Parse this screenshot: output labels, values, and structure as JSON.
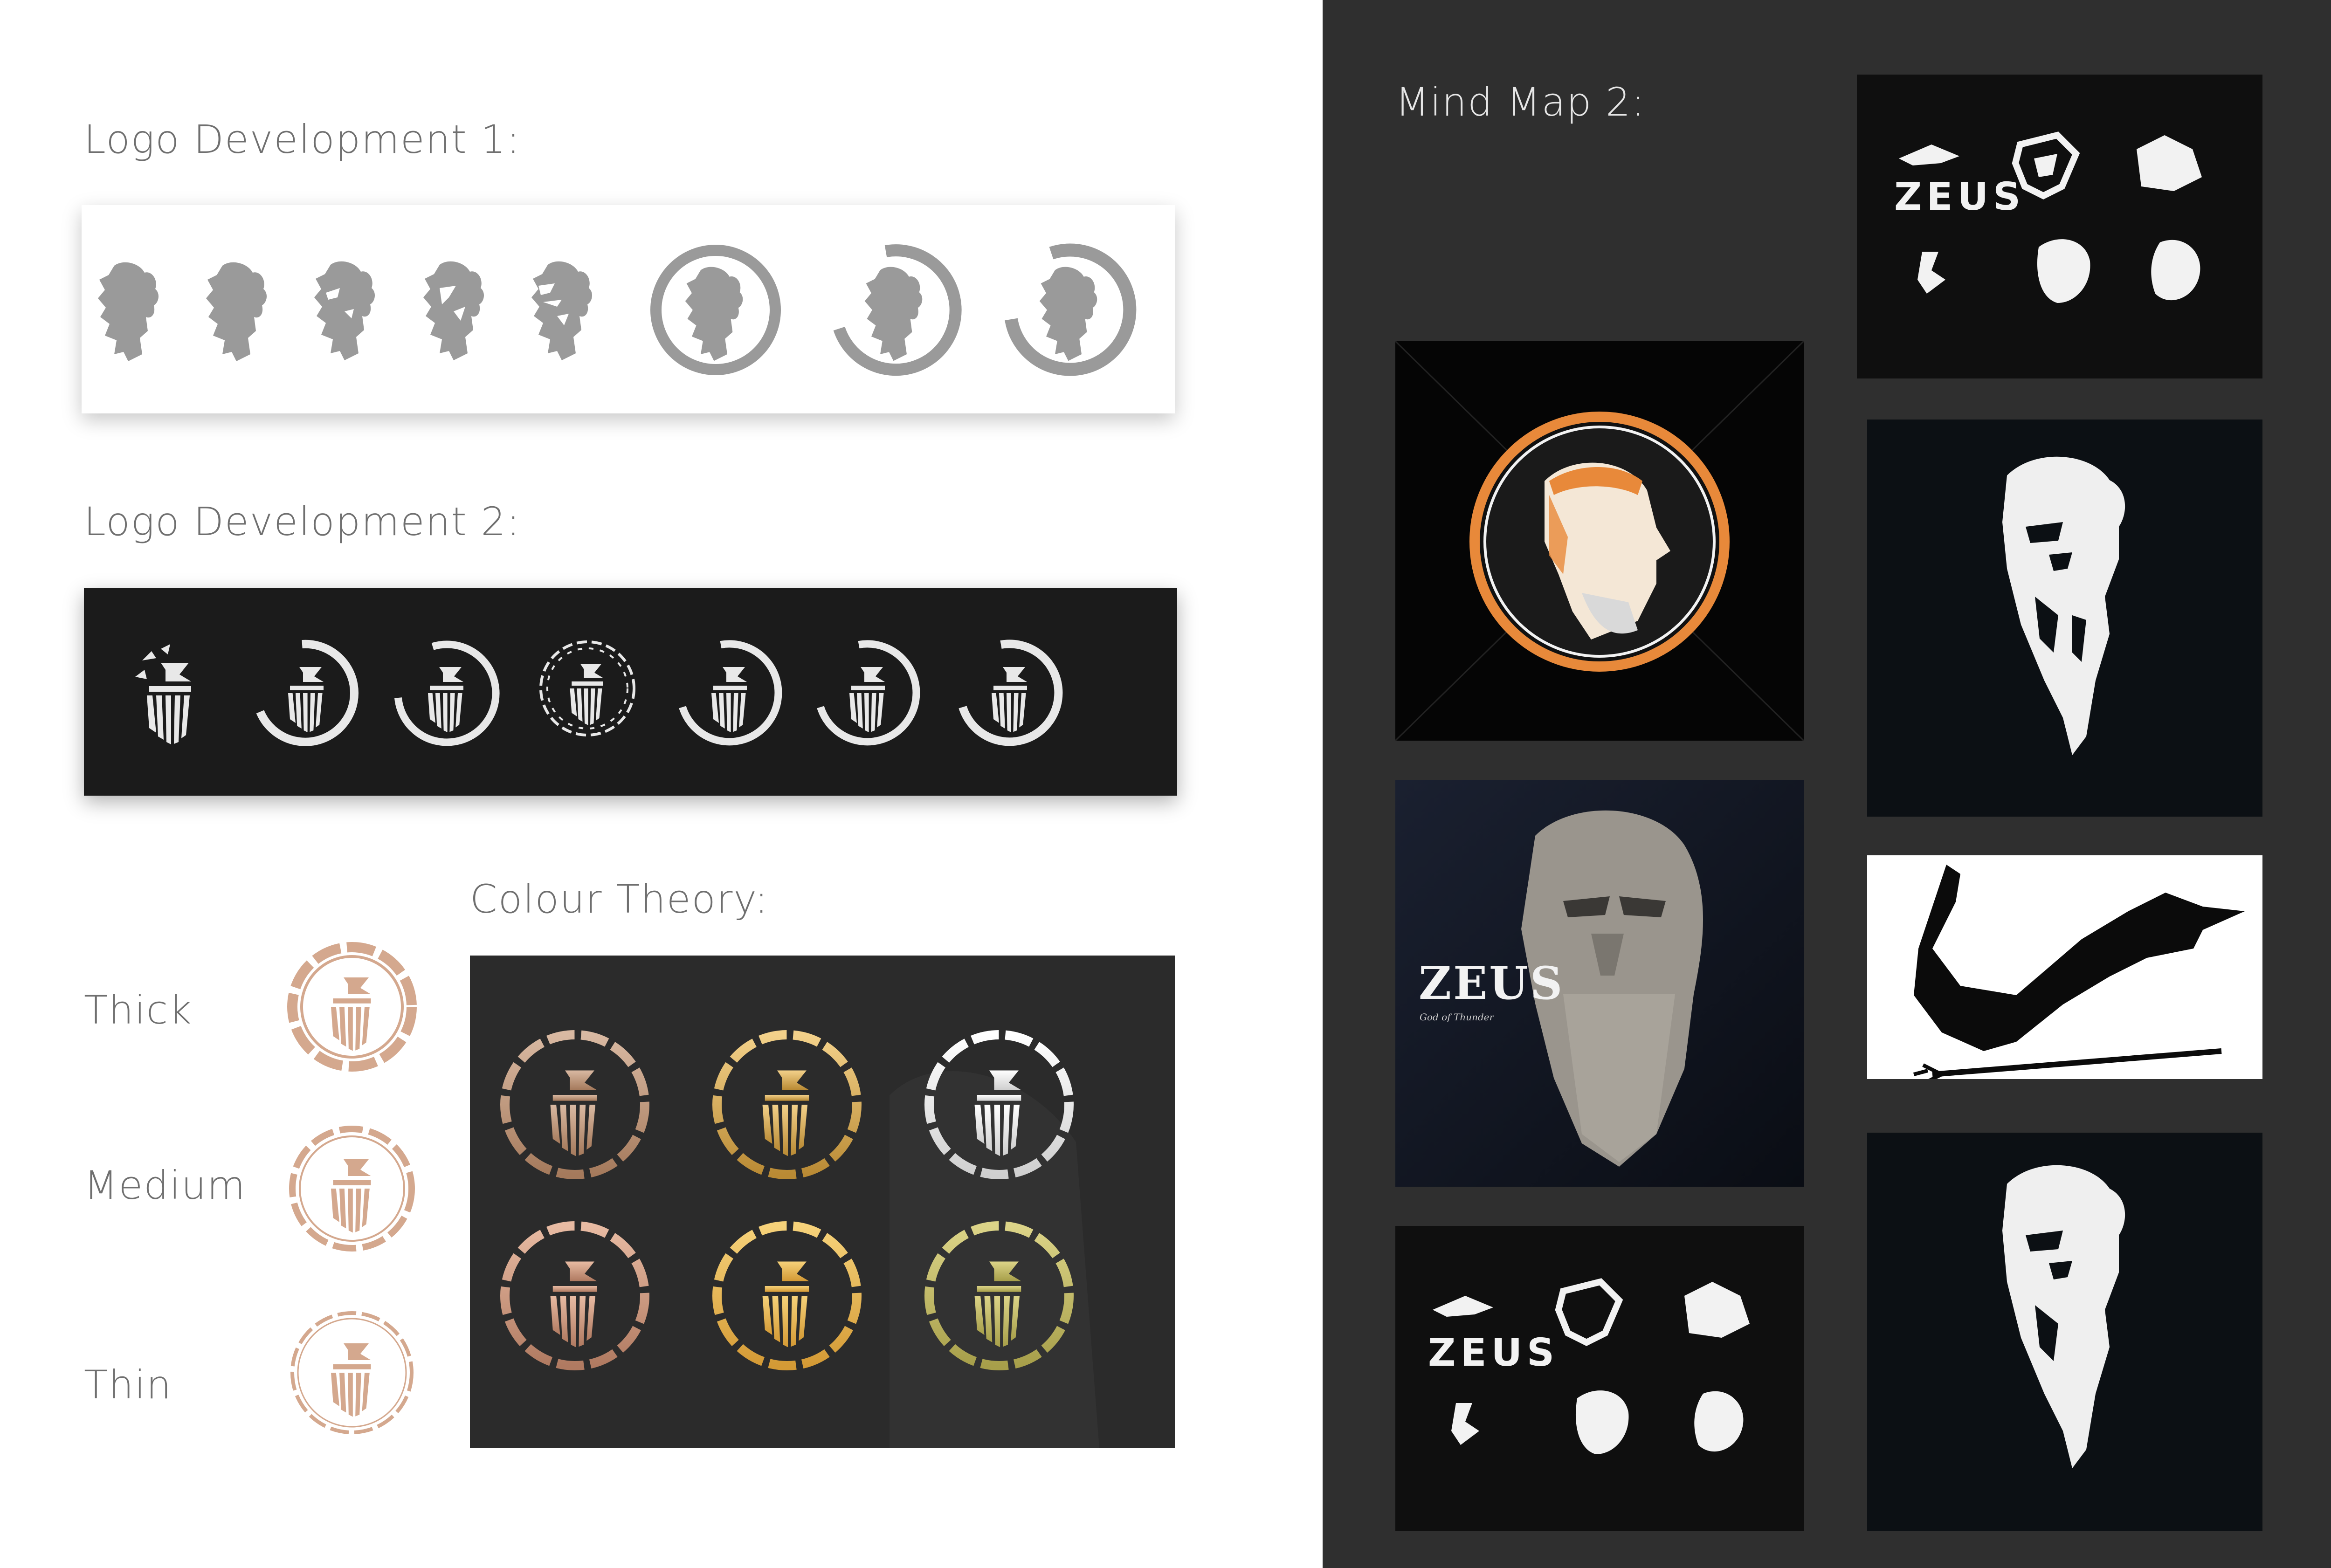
{
  "sections": {
    "logo_dev_1": "Logo Development 1:",
    "logo_dev_2": "Logo Development 2:",
    "colour_theory": "Colour Theory:",
    "mind_map_2": "Mind Map 2:"
  },
  "weights": [
    "Thick",
    "Medium",
    "Thin"
  ],
  "mood_text": {
    "zeus_word": "ZEUS",
    "zeus_poster_title": "ZEUS",
    "zeus_poster_subtitle": "God of Thunder"
  },
  "colors": {
    "grey_silhouette": "#9a9a9a",
    "dev2_stroke": "#e8e8e8",
    "bronze": "#c9a489",
    "rose_gold": "#d4a88e",
    "gold": "#e0b460",
    "olive_gold": "#c9c06a",
    "silver": "#f2f2f2",
    "orange_accent": "#e8893a"
  },
  "icons": {
    "dev1": [
      "zeus-head-silhouette-icon",
      "zeus-head-circle-icon"
    ],
    "dev2": [
      "zeus-geometric-head-icon",
      "zeus-geometric-circle-icon"
    ],
    "mood": [
      "zeus-stone-bust",
      "zeus-medallion",
      "zeus-flying-figure"
    ]
  }
}
